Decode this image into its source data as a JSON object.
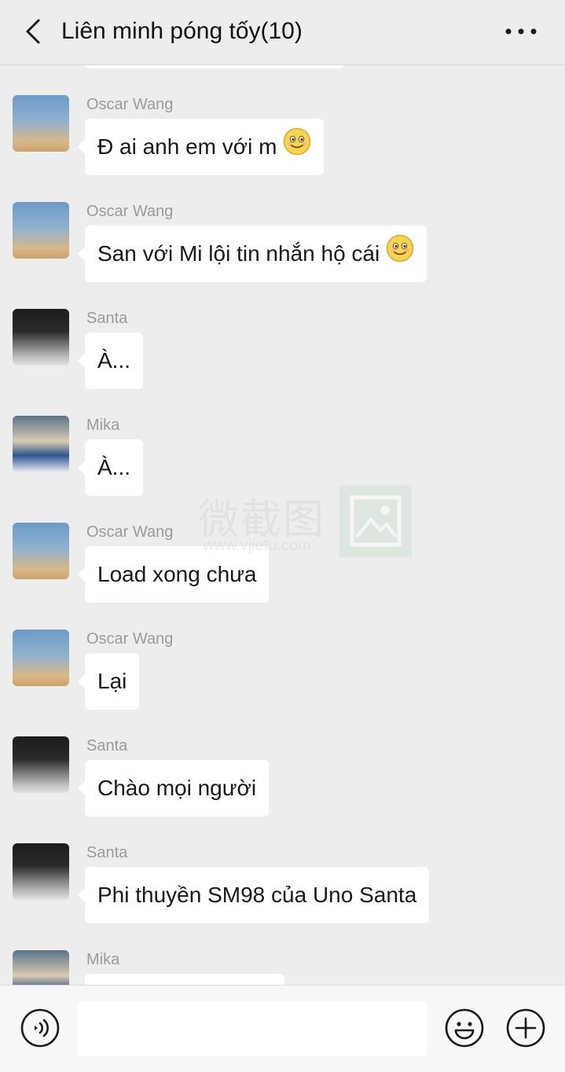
{
  "header": {
    "title": "Liên minh póng tốy(10)"
  },
  "messages": [
    {
      "sender": "Oscar Wang",
      "avatar": "oscar",
      "text": "Đ ai anh em với m",
      "emoji": "smile-emoji"
    },
    {
      "sender": "Oscar Wang",
      "avatar": "oscar",
      "text": "San với Mi lội tin nhắn hộ cái",
      "emoji": "smile-emoji"
    },
    {
      "sender": "Santa",
      "avatar": "santa",
      "text": "À..."
    },
    {
      "sender": "Mika",
      "avatar": "mika",
      "text": "À..."
    },
    {
      "sender": "Oscar Wang",
      "avatar": "oscar",
      "text": "Load xong chưa"
    },
    {
      "sender": "Oscar Wang",
      "avatar": "oscar",
      "text": "Lại"
    },
    {
      "sender": "Santa",
      "avatar": "santa",
      "text": "Chào mọi người"
    },
    {
      "sender": "Santa",
      "avatar": "santa",
      "text": "Phi thuyền SM98 của Uno Santa"
    },
    {
      "sender": "Mika",
      "avatar": "mika",
      "text": ""
    }
  ],
  "watermark": {
    "text": "微截图",
    "url": "www.vjietu.com"
  },
  "footer": {
    "input_value": "",
    "icons": [
      "voice-icon",
      "emoji-icon",
      "plus-icon"
    ]
  },
  "colors": {
    "background": "#ededed",
    "bubble": "#ffffff",
    "sender_text": "#9a9a9a",
    "icon": "#1a1a1a"
  }
}
